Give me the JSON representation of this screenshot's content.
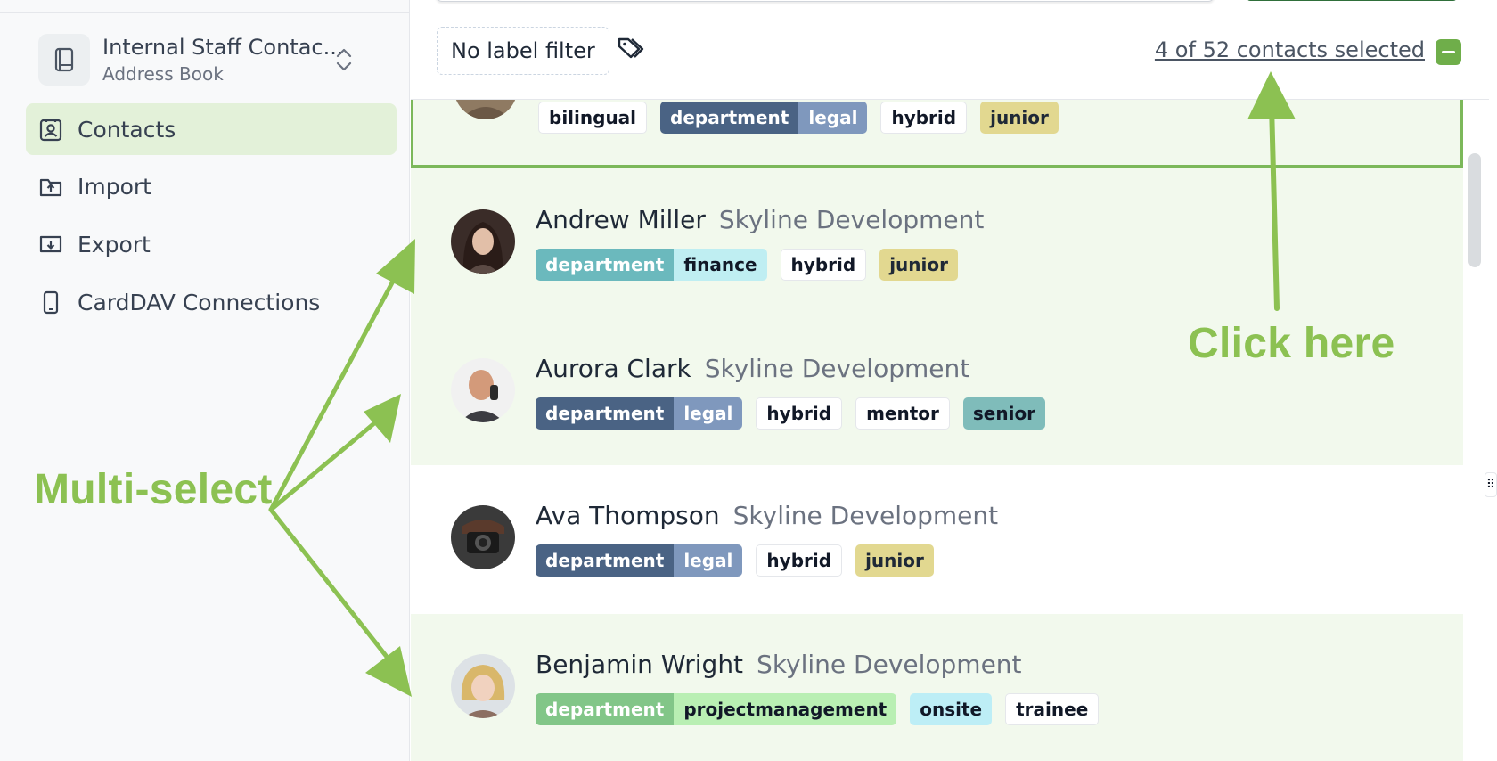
{
  "sidebar": {
    "address_book": {
      "title": "Internal Staff Contac...",
      "subtitle": "Address Book",
      "icon": "book-icon",
      "switch_icon": "chevron-up-down-icon"
    },
    "nav": [
      {
        "label": "Contacts",
        "icon": "contact-card-icon",
        "active": true
      },
      {
        "label": "Import",
        "icon": "folder-import-icon",
        "active": false
      },
      {
        "label": "Export",
        "icon": "folder-export-icon",
        "active": false
      },
      {
        "label": "CardDAV Connections",
        "icon": "phone-icon",
        "active": false
      }
    ]
  },
  "toolbar": {
    "label_filter": "No label filter",
    "labels_icon": "tags-icon",
    "selected_count": "4 of 52 contacts selected",
    "select_all_icon": "minus-icon"
  },
  "contacts": [
    {
      "name": "",
      "company": "",
      "selected": true,
      "tags": [
        {
          "label": "bilingual"
        },
        {
          "key": "department",
          "value": "legal"
        },
        {
          "label": "hybrid"
        },
        {
          "label": "junior"
        }
      ]
    },
    {
      "name": "Andrew Miller",
      "company": "Skyline Development",
      "selected": true,
      "tags": [
        {
          "key": "department",
          "value": "finance"
        },
        {
          "label": "hybrid"
        },
        {
          "label": "junior"
        }
      ]
    },
    {
      "name": "Aurora Clark",
      "company": "Skyline Development",
      "selected": true,
      "tags": [
        {
          "key": "department",
          "value": "legal"
        },
        {
          "label": "hybrid"
        },
        {
          "label": "mentor"
        },
        {
          "label": "senior"
        }
      ]
    },
    {
      "name": "Ava Thompson",
      "company": "Skyline Development",
      "selected": false,
      "tags": [
        {
          "key": "department",
          "value": "legal"
        },
        {
          "label": "hybrid"
        },
        {
          "label": "junior"
        }
      ]
    },
    {
      "name": "Benjamin Wright",
      "company": "Skyline Development",
      "selected": true,
      "tags": [
        {
          "key": "department",
          "value": "projectmanagement"
        },
        {
          "label": "onsite"
        },
        {
          "label": "trainee"
        }
      ]
    }
  ],
  "annotations": {
    "multi_select": "Multi-select",
    "click_here": "Click here"
  },
  "colors": {
    "accent_green": "#8cc152",
    "selected_row_bg": "#f2f9ed",
    "legal_key": "#4a6384",
    "legal_value": "#7f98bd",
    "finance_key": "#6bb9bd",
    "finance_value": "#bfeef2",
    "pm_key": "#82c688",
    "pm_value": "#b9efb3",
    "junior": "#e2d890",
    "senior": "#7fbcba",
    "onsite": "#bdeef6"
  },
  "resize_handle_glyph": "⠿"
}
